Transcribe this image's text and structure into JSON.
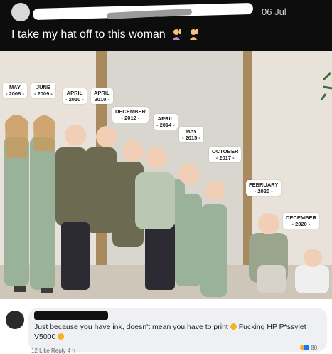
{
  "post": {
    "date": "06 Jul",
    "caption": "I take my hat off to this woman",
    "caption_emojis": [
      "woman-raising-hand-emoji",
      "woman-raising-hand-emoji"
    ]
  },
  "photo": {
    "birth_labels": [
      {
        "month": "MAY",
        "year": "- 2008 -"
      },
      {
        "month": "JUNE",
        "year": "- 2009 -"
      },
      {
        "month": "APRIL",
        "year": "- 2010 -"
      },
      {
        "month": "APRIL",
        "year": "2010 -"
      },
      {
        "month": "DECEMBER",
        "year": "- 2012 -"
      },
      {
        "month": "APRIL",
        "year": "- 2014 -"
      },
      {
        "month": "MAY",
        "year": "- 2015 -"
      },
      {
        "month": "OCTOBER",
        "year": "- 2017 -"
      },
      {
        "month": "FEBRUARY",
        "year": "- 2020 -"
      },
      {
        "month": "DECEMBER",
        "year": "- 2020 -"
      }
    ]
  },
  "comment": {
    "text": "Just because you have ink, doesn't mean you have to print",
    "text2": "Fucking HP P*ssyjet V5000",
    "actions": "12   Like   Reply   4 h",
    "reaction_count": "80"
  },
  "colors": {
    "header_bg": "#0d0d0d",
    "bubble_bg": "#eef0f3",
    "like_blue": "#1877f2",
    "haha_yellow": "#f7b125"
  }
}
